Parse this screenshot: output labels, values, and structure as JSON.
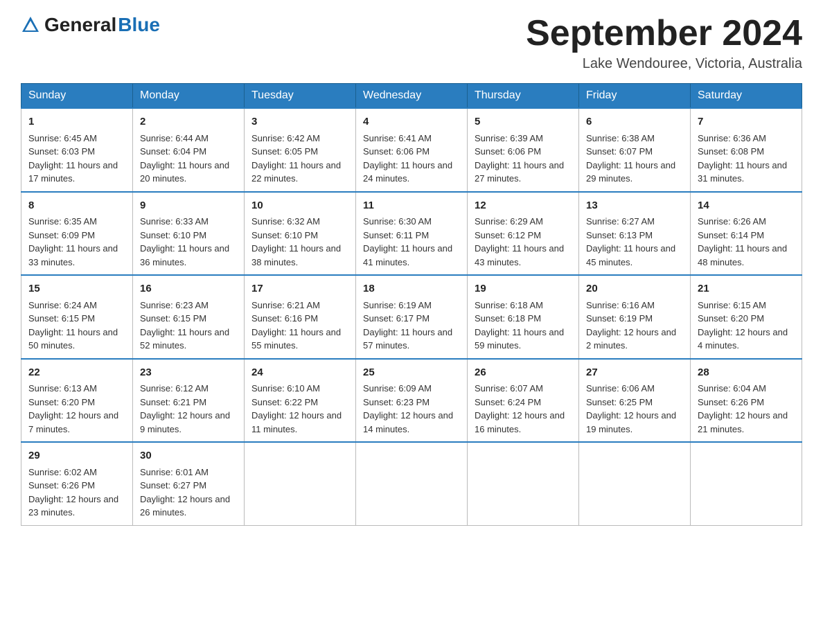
{
  "header": {
    "logo_general": "General",
    "logo_blue": "Blue",
    "month_title": "September 2024",
    "location": "Lake Wendouree, Victoria, Australia"
  },
  "days_of_week": [
    "Sunday",
    "Monday",
    "Tuesday",
    "Wednesday",
    "Thursday",
    "Friday",
    "Saturday"
  ],
  "weeks": [
    [
      {
        "day": "1",
        "sunrise": "6:45 AM",
        "sunset": "6:03 PM",
        "daylight": "11 hours and 17 minutes."
      },
      {
        "day": "2",
        "sunrise": "6:44 AM",
        "sunset": "6:04 PM",
        "daylight": "11 hours and 20 minutes."
      },
      {
        "day": "3",
        "sunrise": "6:42 AM",
        "sunset": "6:05 PM",
        "daylight": "11 hours and 22 minutes."
      },
      {
        "day": "4",
        "sunrise": "6:41 AM",
        "sunset": "6:06 PM",
        "daylight": "11 hours and 24 minutes."
      },
      {
        "day": "5",
        "sunrise": "6:39 AM",
        "sunset": "6:06 PM",
        "daylight": "11 hours and 27 minutes."
      },
      {
        "day": "6",
        "sunrise": "6:38 AM",
        "sunset": "6:07 PM",
        "daylight": "11 hours and 29 minutes."
      },
      {
        "day": "7",
        "sunrise": "6:36 AM",
        "sunset": "6:08 PM",
        "daylight": "11 hours and 31 minutes."
      }
    ],
    [
      {
        "day": "8",
        "sunrise": "6:35 AM",
        "sunset": "6:09 PM",
        "daylight": "11 hours and 33 minutes."
      },
      {
        "day": "9",
        "sunrise": "6:33 AM",
        "sunset": "6:10 PM",
        "daylight": "11 hours and 36 minutes."
      },
      {
        "day": "10",
        "sunrise": "6:32 AM",
        "sunset": "6:10 PM",
        "daylight": "11 hours and 38 minutes."
      },
      {
        "day": "11",
        "sunrise": "6:30 AM",
        "sunset": "6:11 PM",
        "daylight": "11 hours and 41 minutes."
      },
      {
        "day": "12",
        "sunrise": "6:29 AM",
        "sunset": "6:12 PM",
        "daylight": "11 hours and 43 minutes."
      },
      {
        "day": "13",
        "sunrise": "6:27 AM",
        "sunset": "6:13 PM",
        "daylight": "11 hours and 45 minutes."
      },
      {
        "day": "14",
        "sunrise": "6:26 AM",
        "sunset": "6:14 PM",
        "daylight": "11 hours and 48 minutes."
      }
    ],
    [
      {
        "day": "15",
        "sunrise": "6:24 AM",
        "sunset": "6:15 PM",
        "daylight": "11 hours and 50 minutes."
      },
      {
        "day": "16",
        "sunrise": "6:23 AM",
        "sunset": "6:15 PM",
        "daylight": "11 hours and 52 minutes."
      },
      {
        "day": "17",
        "sunrise": "6:21 AM",
        "sunset": "6:16 PM",
        "daylight": "11 hours and 55 minutes."
      },
      {
        "day": "18",
        "sunrise": "6:19 AM",
        "sunset": "6:17 PM",
        "daylight": "11 hours and 57 minutes."
      },
      {
        "day": "19",
        "sunrise": "6:18 AM",
        "sunset": "6:18 PM",
        "daylight": "11 hours and 59 minutes."
      },
      {
        "day": "20",
        "sunrise": "6:16 AM",
        "sunset": "6:19 PM",
        "daylight": "12 hours and 2 minutes."
      },
      {
        "day": "21",
        "sunrise": "6:15 AM",
        "sunset": "6:20 PM",
        "daylight": "12 hours and 4 minutes."
      }
    ],
    [
      {
        "day": "22",
        "sunrise": "6:13 AM",
        "sunset": "6:20 PM",
        "daylight": "12 hours and 7 minutes."
      },
      {
        "day": "23",
        "sunrise": "6:12 AM",
        "sunset": "6:21 PM",
        "daylight": "12 hours and 9 minutes."
      },
      {
        "day": "24",
        "sunrise": "6:10 AM",
        "sunset": "6:22 PM",
        "daylight": "12 hours and 11 minutes."
      },
      {
        "day": "25",
        "sunrise": "6:09 AM",
        "sunset": "6:23 PM",
        "daylight": "12 hours and 14 minutes."
      },
      {
        "day": "26",
        "sunrise": "6:07 AM",
        "sunset": "6:24 PM",
        "daylight": "12 hours and 16 minutes."
      },
      {
        "day": "27",
        "sunrise": "6:06 AM",
        "sunset": "6:25 PM",
        "daylight": "12 hours and 19 minutes."
      },
      {
        "day": "28",
        "sunrise": "6:04 AM",
        "sunset": "6:26 PM",
        "daylight": "12 hours and 21 minutes."
      }
    ],
    [
      {
        "day": "29",
        "sunrise": "6:02 AM",
        "sunset": "6:26 PM",
        "daylight": "12 hours and 23 minutes."
      },
      {
        "day": "30",
        "sunrise": "6:01 AM",
        "sunset": "6:27 PM",
        "daylight": "12 hours and 26 minutes."
      },
      null,
      null,
      null,
      null,
      null
    ]
  ],
  "labels": {
    "sunrise": "Sunrise:",
    "sunset": "Sunset:",
    "daylight": "Daylight:"
  }
}
